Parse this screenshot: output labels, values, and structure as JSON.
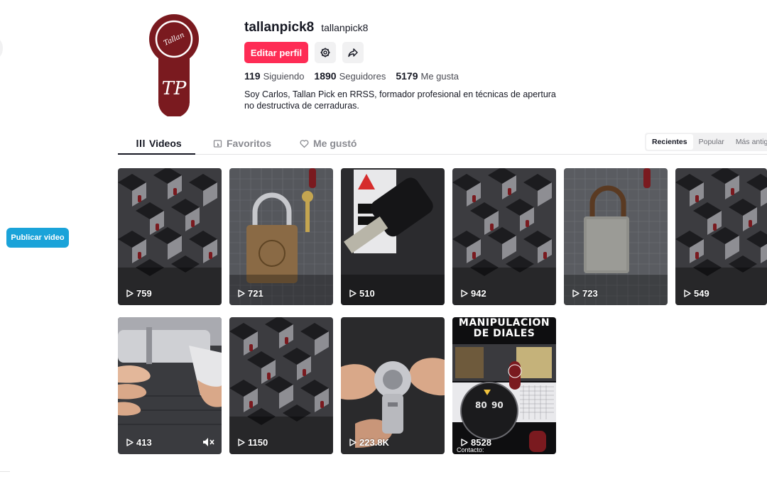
{
  "sidebar": {
    "publish_label": "Publicar video"
  },
  "profile": {
    "username": "tallanpick8",
    "nickname": "tallanpick8",
    "edit_label": "Editar perfil",
    "stats": [
      {
        "value": "119",
        "label": "Siguiendo"
      },
      {
        "value": "1890",
        "label": "Seguidores"
      },
      {
        "value": "5179",
        "label": "Me gusta"
      }
    ],
    "bio": "Soy Carlos, Tallan Pick en RRSS, formador profesional en técnicas de apertura no destructiva de cerraduras.",
    "avatar_text": "TP",
    "avatar_script": "Tallan"
  },
  "tabs": [
    {
      "label": "Videos",
      "icon": "grid-icon",
      "active": true
    },
    {
      "label": "Favoritos",
      "icon": "bookmark-icon",
      "active": false
    },
    {
      "label": "Me gustó",
      "icon": "heart-icon",
      "active": false
    }
  ],
  "sort": [
    {
      "label": "Recientes",
      "active": true
    },
    {
      "label": "Popular",
      "active": false
    },
    {
      "label": "Más antiguo",
      "active": false
    }
  ],
  "videos": [
    {
      "views": "759",
      "kind": "cubes"
    },
    {
      "views": "721",
      "kind": "padlock"
    },
    {
      "views": "510",
      "kind": "brady"
    },
    {
      "views": "942",
      "kind": "cubes"
    },
    {
      "views": "723",
      "kind": "rusty"
    },
    {
      "views": "549",
      "kind": "cubes"
    },
    {
      "views": "413",
      "kind": "cylinder"
    },
    {
      "views": "1150",
      "kind": "cubes"
    },
    {
      "views": "223.8K",
      "kind": "camlock"
    },
    {
      "views": "8528",
      "kind": "dial",
      "overlay_line1": "MANIPULACION",
      "overlay_line2": "DE DIALES",
      "contact": "Contacto:"
    }
  ],
  "colors": {
    "accent": "#fe2c55",
    "publish": "#1aa3d9",
    "brand": "#7a1a1f"
  }
}
